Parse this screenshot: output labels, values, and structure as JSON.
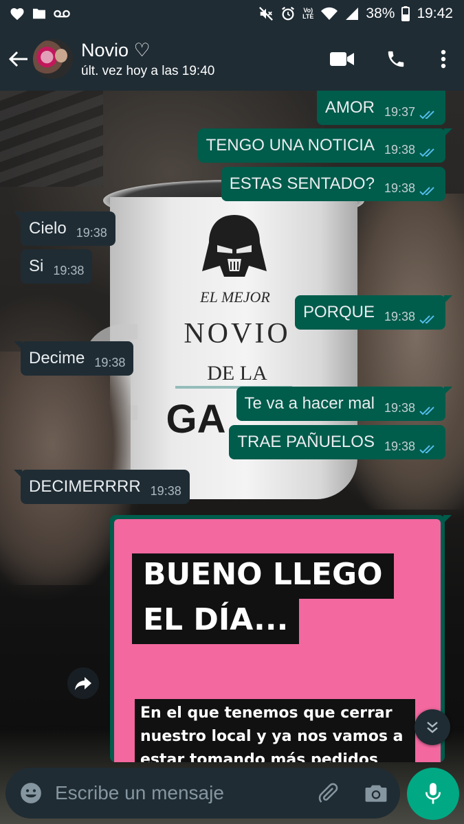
{
  "status_bar": {
    "battery": "38%",
    "time": "19:42",
    "volte_top": "Vo)",
    "volte_bottom": "LTE",
    "icons": [
      "heart-icon",
      "folder-icon",
      "voicemail-icon",
      "mute-icon",
      "alarm-icon",
      "volte-icon",
      "wifi-icon",
      "signal-icon",
      "battery-icon"
    ]
  },
  "header": {
    "contact_name": "Novio ♡",
    "last_seen": "últ. vez hoy a las 19:40",
    "icons": [
      "back-arrow-icon",
      "video-call-icon",
      "phone-icon",
      "more-vert-icon"
    ]
  },
  "messages": [
    {
      "dir": "out",
      "text": "AMOR",
      "time": "19:37"
    },
    {
      "dir": "out",
      "text": "TENGO UNA NOTICIA",
      "time": "19:38"
    },
    {
      "dir": "out",
      "text": "ESTAS SENTADO?",
      "time": "19:38"
    },
    {
      "dir": "in",
      "text": "Cielo",
      "time": "19:38"
    },
    {
      "dir": "in",
      "text": "Si",
      "time": "19:38"
    },
    {
      "dir": "out",
      "text": "PORQUE",
      "time": "19:38"
    },
    {
      "dir": "in",
      "text": "Decime",
      "time": "19:38"
    },
    {
      "dir": "out",
      "text": "Te va a hacer mal",
      "time": "19:38"
    },
    {
      "dir": "out",
      "text": "TRAE PAÑUELOS",
      "time": "19:38"
    },
    {
      "dir": "in",
      "text": "DECIMERRRR",
      "time": "19:38"
    }
  ],
  "image_message": {
    "title_line1": "BUENO LLEGO",
    "title_line2": "EL DÍA...",
    "sub_line1": "En el que tenemos que cerrar",
    "sub_line2": "nuestro local y ya nos vamos a",
    "sub_line3": "estar tomando más pedidos",
    "background_color": "#f2689f"
  },
  "wallpaper_mug": {
    "line1": "EL MEJOR",
    "line2": "NOVIO",
    "line3": "DE LA",
    "line4": "GA"
  },
  "input": {
    "placeholder": "Escribe un mensaje",
    "icons": [
      "emoji-icon",
      "attach-icon",
      "camera-icon",
      "mic-icon"
    ]
  },
  "colors": {
    "header_bg": "#1f2c34",
    "outgoing_bubble": "#005c4b",
    "incoming_bubble": "#1f2c34",
    "read_ticks": "#53bdeb",
    "accent": "#00a884"
  }
}
